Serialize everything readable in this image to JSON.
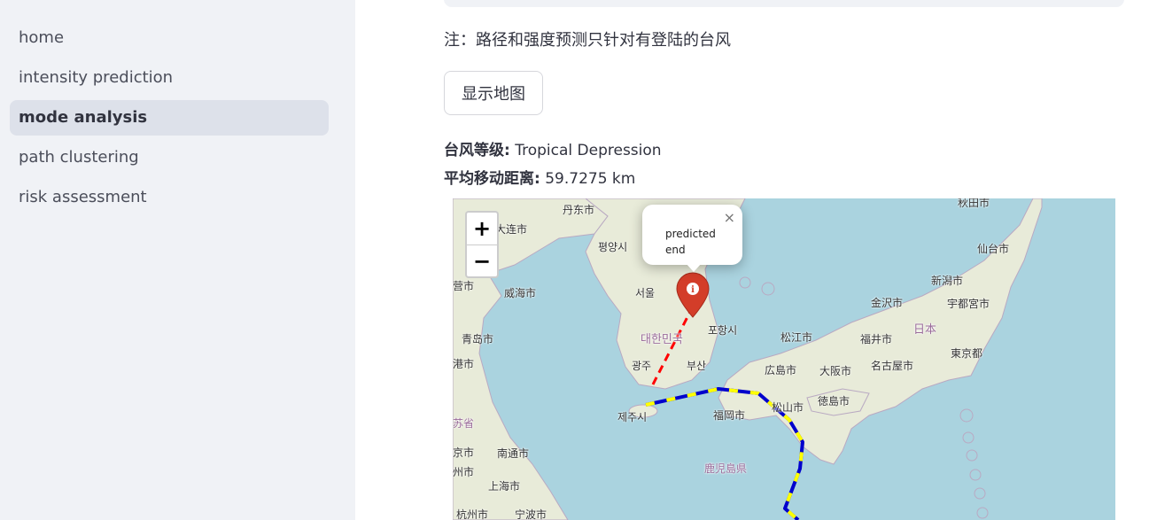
{
  "sidebar": {
    "items": [
      {
        "label": "home"
      },
      {
        "label": "intensity prediction"
      },
      {
        "label": "mode analysis"
      },
      {
        "label": "path clustering"
      },
      {
        "label": "risk assessment"
      }
    ],
    "active": "mode analysis"
  },
  "main": {
    "note": "注：路径和强度预测只针对有登陆的台风",
    "show_map_label": "显示地图",
    "typhoon_level_label": "台风等级:",
    "typhoon_level_value": "Tropical Depression",
    "avg_distance_label": "平均移动距离:",
    "avg_distance_value": "59.7275 km"
  },
  "map": {
    "zoom_in": "+",
    "zoom_out": "−",
    "popup_text": "predicted end",
    "popup_close": "×",
    "marker_color": "#d33d29",
    "track_colors": {
      "main": "#0000cc",
      "highlight": "#ffff00",
      "prediction": "#ff0000"
    },
    "labels": {
      "dandong": "丹东市",
      "dalian": "大连市",
      "pyongyang": "평양시",
      "yingkou": "营市",
      "weihai": "威海市",
      "seoul": "서울",
      "qingdao": "青岛市",
      "korea": "대한민국",
      "pohang": "포항시",
      "gwangju": "광주",
      "busan": "부산",
      "lianyungang": "港市",
      "jeju": "제주시",
      "jiangsu": "苏省",
      "fukuoka": "福岡市",
      "nanjing": "京市",
      "nantong": "南通市",
      "zhou": "州市",
      "shanghai": "上海市",
      "kagoshima": "鹿児島県",
      "hangzhou": "杭州市",
      "ningbo": "宁波市",
      "matsue": "松江市",
      "hiroshima": "広島市",
      "osaka": "大阪市",
      "matsuyama": "松山市",
      "tokushima": "徳島市",
      "fukui": "福井市",
      "kanazawa": "金沢市",
      "nagoya": "名古屋市",
      "japan": "日本",
      "tokyo": "東京都",
      "niigata": "新潟市",
      "utsunomiya": "宇都宮市",
      "sendai": "仙台市",
      "akita": "秋田市"
    }
  }
}
